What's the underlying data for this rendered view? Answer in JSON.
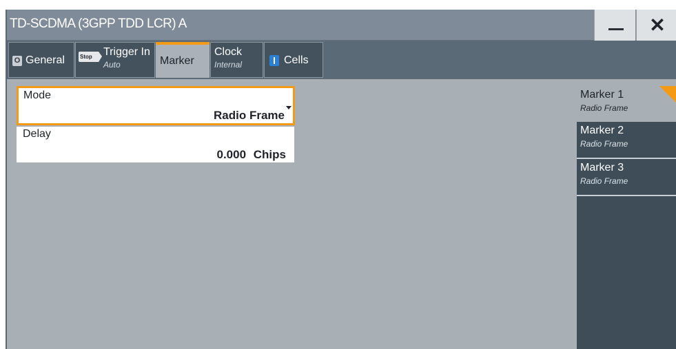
{
  "window": {
    "title": "TD-SCDMA (3GPP TDD LCR) A",
    "minimize_icon": "minimize-icon",
    "close_icon": "close-icon"
  },
  "tabs": [
    {
      "label": "General",
      "sublabel": "",
      "indicator": "O"
    },
    {
      "label": "Trigger In",
      "sublabel": "Auto",
      "indicator": "Stop"
    },
    {
      "label": "Marker",
      "sublabel": ""
    },
    {
      "label": "Clock",
      "sublabel": "Internal"
    },
    {
      "label": "Cells",
      "sublabel": "",
      "indicator": "I"
    }
  ],
  "fields": {
    "mode": {
      "label": "Mode",
      "value": "Radio Frame"
    },
    "delay": {
      "label": "Delay",
      "value": "0.000",
      "unit": "Chips"
    }
  },
  "markers": [
    {
      "label": "Marker 1",
      "sub": "Radio Frame"
    },
    {
      "label": "Marker 2",
      "sub": "Radio Frame"
    },
    {
      "label": "Marker 3",
      "sub": "Radio Frame"
    }
  ],
  "colors": {
    "accent": "#f59a14",
    "led_blue": "#2a7fd6"
  }
}
